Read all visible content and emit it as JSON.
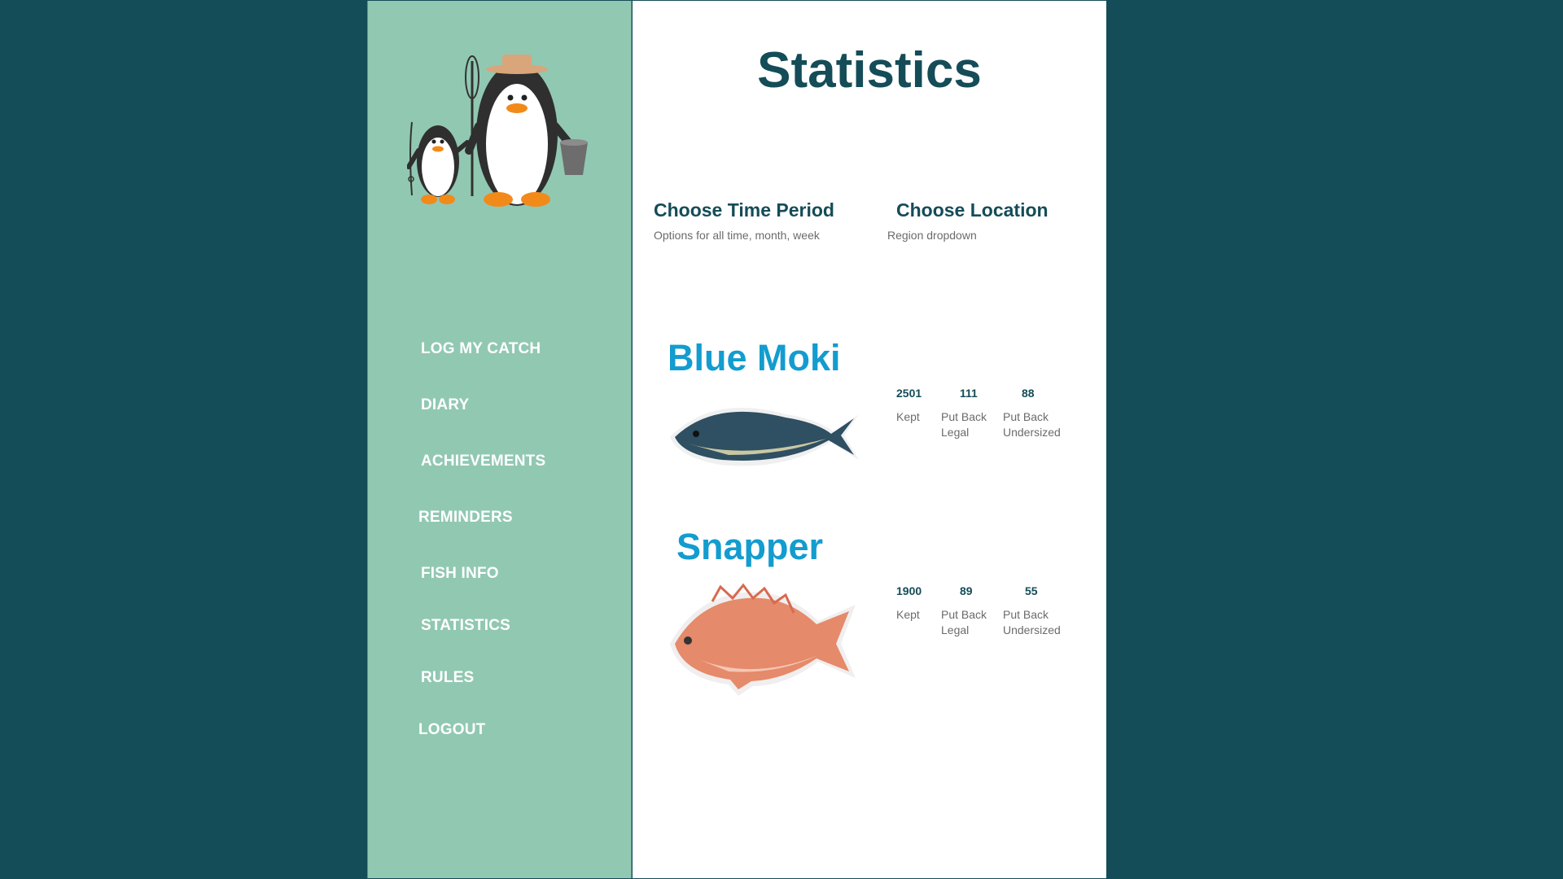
{
  "page": {
    "title": "Statistics"
  },
  "colors": {
    "background": "#144c58",
    "sidebar": "#91c8b2",
    "heading": "#144c58",
    "fish_name": "#139ccf"
  },
  "sidebar": {
    "logo": "penguin-family-fishing-logo",
    "items": [
      {
        "label": "LOG MY CATCH"
      },
      {
        "label": "DIARY"
      },
      {
        "label": "ACHIEVEMENTS"
      },
      {
        "label": "REMINDERS"
      },
      {
        "label": "FISH INFO"
      },
      {
        "label": "STATISTICS"
      },
      {
        "label": "RULES"
      },
      {
        "label": "LOGOUT"
      }
    ]
  },
  "filters": {
    "time": {
      "title": "Choose Time Period",
      "subtitle": "Options for all time, month, week"
    },
    "location": {
      "title": "Choose Location",
      "subtitle": "Region dropdown"
    }
  },
  "fish": [
    {
      "name": "Blue Moki",
      "image": "blue-moki-fish-photo",
      "stats": [
        {
          "value": "2501",
          "label": "Kept"
        },
        {
          "value": "111",
          "label": "Put Back Legal"
        },
        {
          "value": "88",
          "label": "Put Back Undersized"
        }
      ]
    },
    {
      "name": "Snapper",
      "image": "snapper-fish-photo",
      "stats": [
        {
          "value": "1900",
          "label": "Kept"
        },
        {
          "value": "89",
          "label": "Put Back Legal"
        },
        {
          "value": "55",
          "label": "Put Back Undersized"
        }
      ]
    }
  ]
}
